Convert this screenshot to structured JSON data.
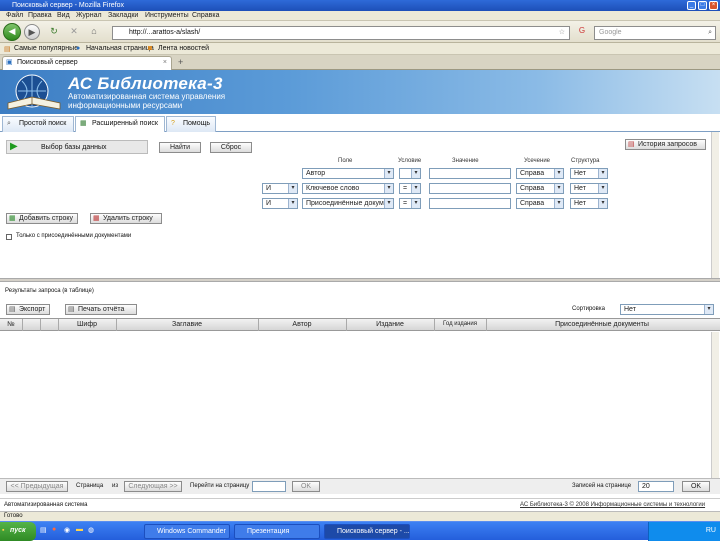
{
  "window": {
    "title": "Поисковый сервер - Mozilla Firefox",
    "minimize": "_",
    "maximize": "□",
    "close": "×"
  },
  "menu": [
    "Файл",
    "Правка",
    "Вид",
    "Журнал",
    "Закладки",
    "Инструменты",
    "Справка"
  ],
  "nav": {
    "url": "http://...arattos-a/slash/",
    "search_placeholder": "Google"
  },
  "bookmarks": [
    "Самые популярные",
    "Начальная страница",
    "Лента новостей"
  ],
  "browser_tab": {
    "label": "Поисковый сервер",
    "new_tab": "+"
  },
  "banner": {
    "title": "АС Библиотека-3",
    "subtitle": "Автоматизированная система управления информационными ресурсами"
  },
  "app_tabs": [
    "Простой поиск",
    "Расширенный поиск",
    "Помощь"
  ],
  "search": {
    "db_label": "Выбор базы данных",
    "find_button": "Найти",
    "reset_button": "Сброс",
    "history_button": "История запросов",
    "headers": {
      "field": "Поле",
      "condition": "Условие",
      "value": "Значение",
      "truncation": "Усечение",
      "structure": "Структура"
    },
    "rows": [
      {
        "logic": "",
        "field": "Автор",
        "condition": "",
        "value": "",
        "truncation": "Справа",
        "structure": "Нет"
      },
      {
        "logic": "И",
        "field": "Ключевое слово",
        "condition": "=",
        "value": "",
        "truncation": "Справа",
        "structure": "Нет"
      },
      {
        "logic": "И",
        "field": "Присоединённые документы",
        "condition": "=",
        "value": "",
        "truncation": "Справа",
        "structure": "Нет"
      }
    ],
    "add_row": "Добавить строку",
    "remove_row": "Удалить строку",
    "only_attached": "Только с присоединёнными документами"
  },
  "results": {
    "title": "Результаты запроса (в таблице)",
    "export_button": "Экспорт",
    "print_button": "Печать отчёта",
    "sort_label": "Сортировка",
    "sort_value": "Нет",
    "columns": [
      "№",
      "",
      "",
      "Шифр",
      "Заглавие",
      "Автор",
      "Издание",
      "Год издания",
      "Присоединённые документы"
    ]
  },
  "pager": {
    "prev": "<< Предыдущая",
    "page_label": "Страница",
    "page_of": "из",
    "next": "Следующая >>",
    "goto_label": "Перейти на страницу",
    "goto_button": "OK",
    "rows_label": "Записей на странице",
    "rows_value": "20",
    "rows_button": "OK"
  },
  "status": {
    "left": "Автоматизированная система",
    "right": "АС Библиотека-3 © 2008 Информационные системы и технологии",
    "browser_status": "Готово"
  },
  "taskbar": {
    "start": "пуск",
    "tasks": [
      "Windows Commander",
      "Презентация",
      "Поисковый сервер - ..."
    ],
    "clock": "RU"
  }
}
